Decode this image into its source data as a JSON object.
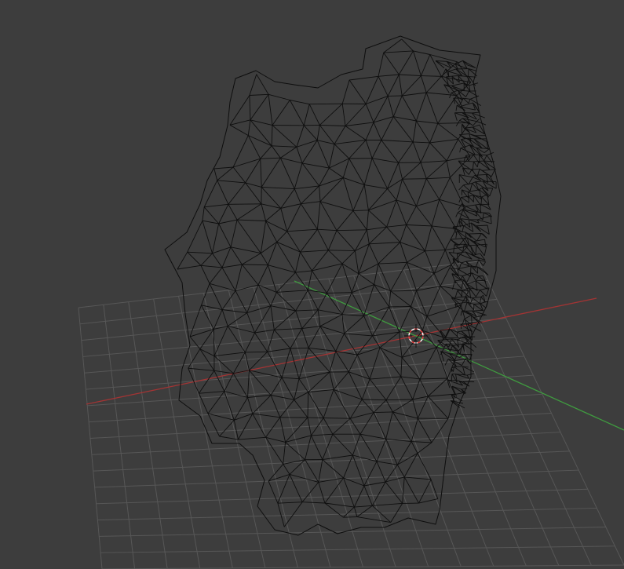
{
  "viewport": {
    "background_color": "#3d3d3d",
    "grid_color": "#575757",
    "x_axis_color": "#a33434",
    "y_axis_color": "#3f9a3f",
    "mesh_wire_color": "#0e0e0e",
    "cursor_colors": [
      "#ffffff",
      "#e03030"
    ]
  },
  "mesh": {
    "object_type": "wireframe-head-mesh",
    "display_mode": "wireframe"
  },
  "cursor": {
    "icon": "3d-cursor-icon"
  }
}
